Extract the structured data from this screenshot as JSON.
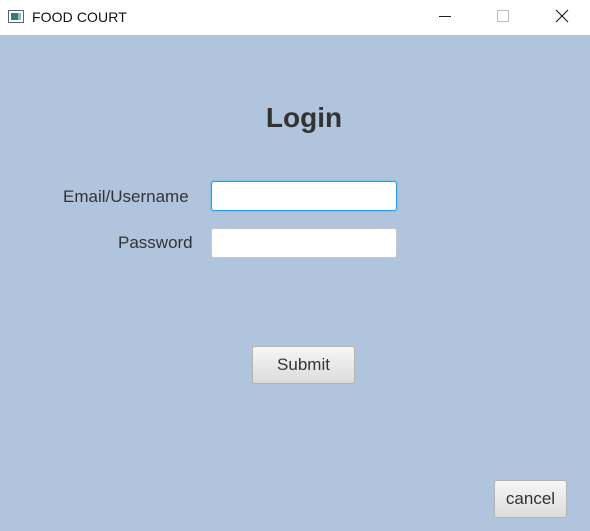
{
  "window": {
    "title": "FOOD COURT",
    "icon": "app-window-icon",
    "controls": [
      "minimize-icon",
      "maximize-icon",
      "close-icon"
    ]
  },
  "form": {
    "heading": "Login",
    "email_label": "Email/Username",
    "email_value": "",
    "password_label": "Password",
    "password_value": "",
    "submit_label": "Submit",
    "cancel_label": "cancel"
  },
  "colors": {
    "background": "#b0c4de",
    "focus_border": "#2b9be0",
    "text": "#333333"
  }
}
